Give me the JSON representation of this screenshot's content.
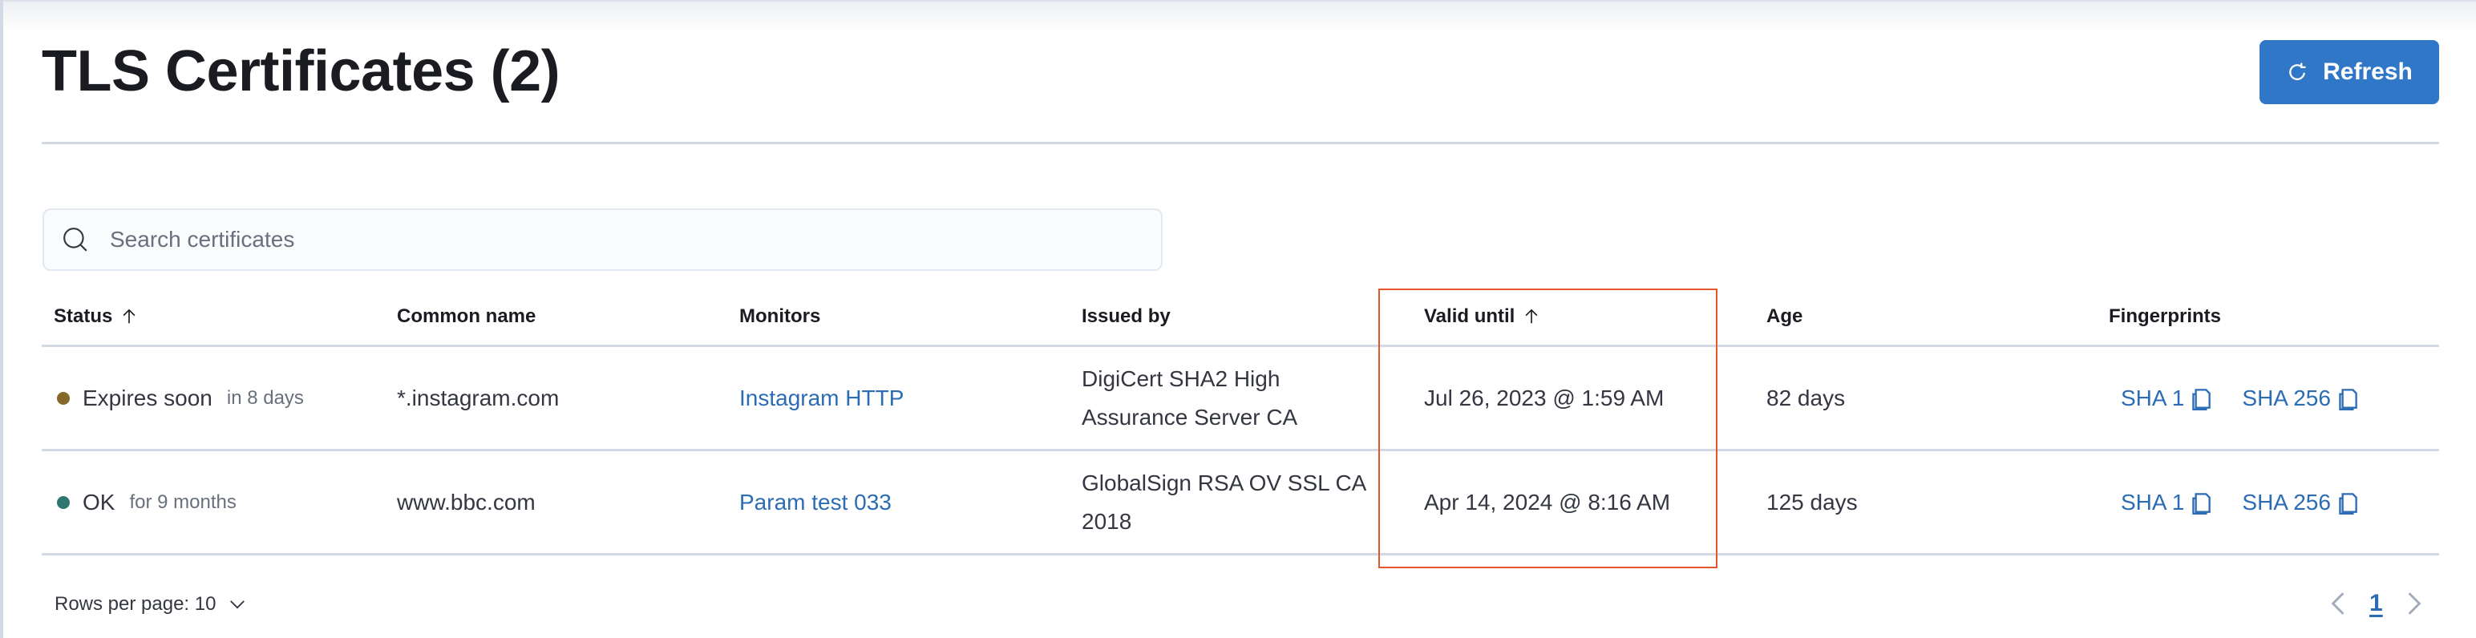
{
  "page": {
    "title": "TLS Certificates (2)",
    "refresh_label": "Refresh"
  },
  "search": {
    "placeholder": "Search certificates",
    "value": ""
  },
  "table": {
    "columns": [
      {
        "label": "Status",
        "sorted": "ascending"
      },
      {
        "label": "Common name"
      },
      {
        "label": "Monitors"
      },
      {
        "label": "Issued by"
      },
      {
        "label": "Valid until",
        "sorted": "ascending"
      },
      {
        "label": "Age"
      },
      {
        "label": "Fingerprints"
      }
    ],
    "rows": [
      {
        "status": "Expires soon",
        "status_detail": "in 8 days",
        "status_color": "#86692a",
        "common_name": "*.instagram.com",
        "monitor": "Instagram HTTP",
        "issued_by": "DigiCert SHA2 High Assurance Server CA",
        "valid_until": "Jul 26, 2023 @ 1:59 AM",
        "age": "82 days",
        "fingerprints": [
          "SHA 1",
          "SHA 256"
        ]
      },
      {
        "status": "OK",
        "status_detail": "for 9 months",
        "status_color": "#2f7670",
        "common_name": "www.bbc.com",
        "monitor": "Param test 033",
        "issued_by": "GlobalSign RSA OV SSL CA 2018",
        "valid_until": "Apr 14, 2024 @ 8:16 AM",
        "age": "125 days",
        "fingerprints": [
          "SHA 1",
          "SHA 256"
        ]
      }
    ]
  },
  "pagination": {
    "rows_per_page_label": "Rows per page: 10",
    "current_page": "1"
  },
  "icons": {
    "refresh": "refresh-icon",
    "search": "search-icon",
    "sort": "arrow-up-icon",
    "copy": "copy-icon",
    "chevron_down": "chevron-down-icon",
    "prev": "chevron-left-icon",
    "next": "chevron-right-icon"
  },
  "colors": {
    "primary": "#3077c8",
    "link": "#2b6cb5",
    "highlight": "#e4572e"
  }
}
